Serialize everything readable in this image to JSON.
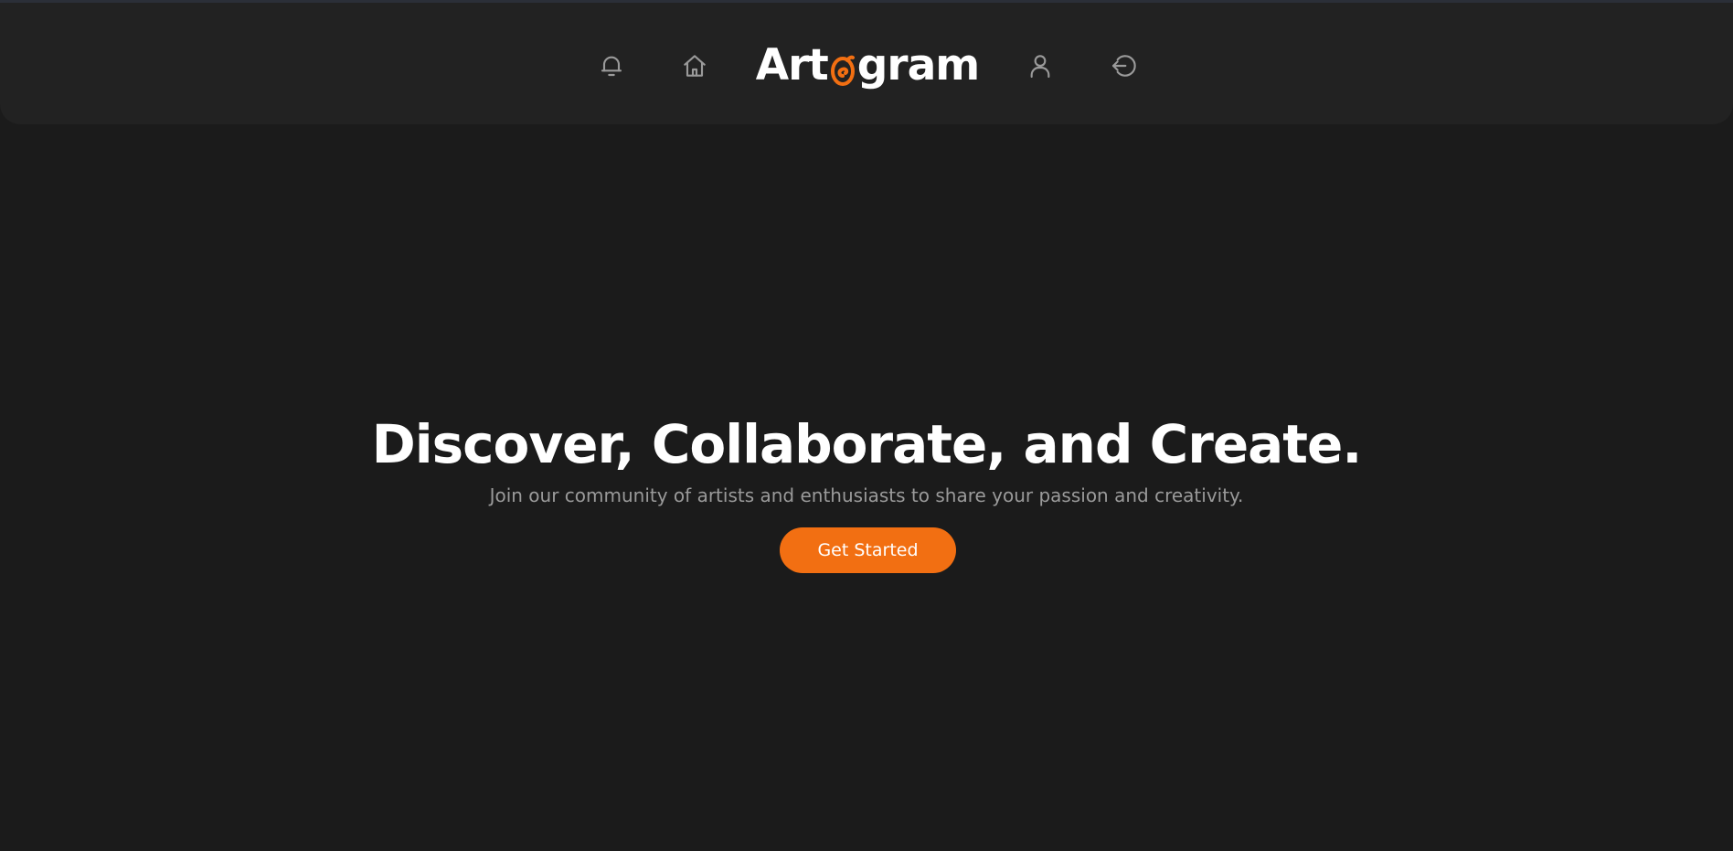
{
  "navbar": {
    "logo": {
      "text_before": "Art",
      "accent_glyph": "o",
      "text_after": "gram",
      "accent_color": "#f26f12"
    },
    "icons": {
      "left_1": "bell-icon",
      "left_2": "home-icon",
      "right_1": "user-icon",
      "right_2": "logout-icon"
    }
  },
  "hero": {
    "title": "Discover, Collaborate, and Create.",
    "subtitle": "Join our community of artists and enthusiasts to share your passion and creativity.",
    "cta_label": "Get Started"
  },
  "colors": {
    "background": "#1b1b1b",
    "navbar": "#222222",
    "accent": "#f26f12",
    "icon": "#9a9a9a",
    "subtitle": "#9a9a9a"
  }
}
